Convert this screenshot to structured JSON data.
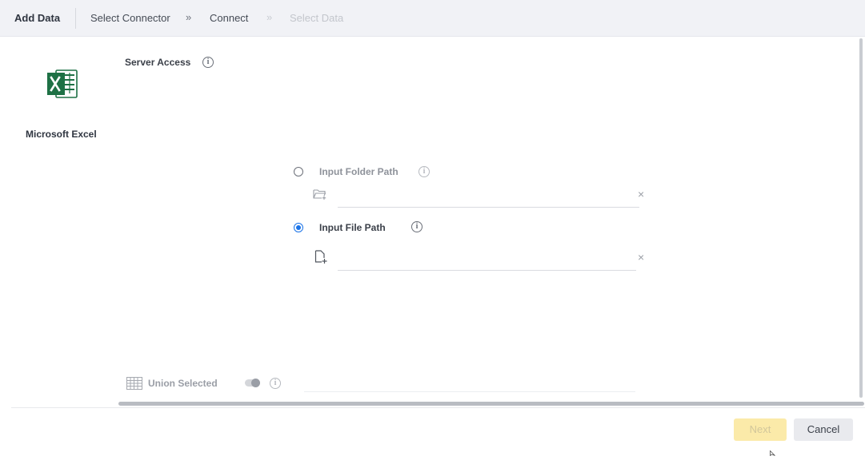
{
  "header": {
    "title": "Add Data",
    "steps": [
      {
        "label": "Select Connector",
        "state": "done"
      },
      {
        "label": "Connect",
        "state": "active"
      },
      {
        "label": "Select Data",
        "state": "disabled"
      }
    ],
    "separator": "»"
  },
  "connector": {
    "name": "Microsoft Excel",
    "icon": "excel-icon",
    "icon_color": "#1e7145"
  },
  "server_access": {
    "title": "Server Access",
    "options": [
      {
        "label": "Input Folder Path",
        "selected": false,
        "icon": "folder-add-icon",
        "value": "",
        "clear": "×"
      },
      {
        "label": "Input File Path",
        "selected": true,
        "icon": "file-add-icon",
        "value": "",
        "clear": "×"
      }
    ]
  },
  "union": {
    "label": "Union Selected",
    "enabled": false,
    "icon": "grid-table-icon"
  },
  "footer": {
    "next_label": "Next",
    "cancel_label": "Cancel"
  },
  "colors": {
    "accent": "#1a73e8",
    "next_button_bg": "#fbeaa9",
    "header_bg": "#f1f2f6"
  }
}
